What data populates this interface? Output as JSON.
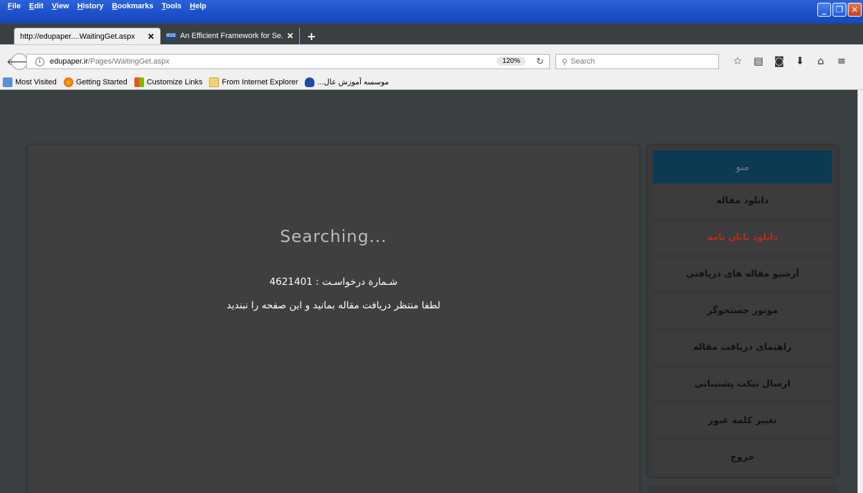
{
  "menubar": [
    "File",
    "Edit",
    "View",
    "History",
    "Bookmarks",
    "Tools",
    "Help"
  ],
  "tabs": [
    {
      "title": "http://edupaper....WaitingGet.aspx",
      "active": true
    },
    {
      "title": "An Efficient Framework for Se...",
      "active": false,
      "favicon": "IEEE"
    }
  ],
  "navbar": {
    "url_host": "edupaper.ir",
    "url_path": "/Pages/WaitingGet.aspx",
    "zoom": "120%",
    "search_placeholder": "Search"
  },
  "bookmarks": [
    {
      "label": "Most Visited",
      "icon": "most-visited-icon"
    },
    {
      "label": "Getting Started",
      "icon": "firefox-icon"
    },
    {
      "label": "Customize Links",
      "icon": "windows-icon"
    },
    {
      "label": "From Internet Explorer",
      "icon": "folder-icon"
    },
    {
      "label": "...موسسه آموزش عال",
      "icon": "institute-icon"
    }
  ],
  "main": {
    "status": "Searching...",
    "request_line": "شـمارة درخواسـت : 4621401",
    "wait_line": "لطفا منتظر دریافت مقاله بمانید و این صفحه را نبندید"
  },
  "sidebar": {
    "header": "منو",
    "items": [
      {
        "label": "دانلود مقاله"
      },
      {
        "label": "دانلود پایان نامه"
      },
      {
        "label": "آرشیو مقاله های دریافتی"
      },
      {
        "label": "موتور جستجوگر"
      },
      {
        "label": "راهنمای دریافت مقاله"
      },
      {
        "label": "ارسال تیکت پشتیبانی"
      },
      {
        "label": "تغییر کلمه عبور"
      },
      {
        "label": "خروج"
      }
    ]
  },
  "colors": {
    "page_bg": "#3a3f42",
    "panel_bg": "#3f3f3f",
    "menu_header_bg": "#0b3a52",
    "accent_item": "#b52f18"
  }
}
